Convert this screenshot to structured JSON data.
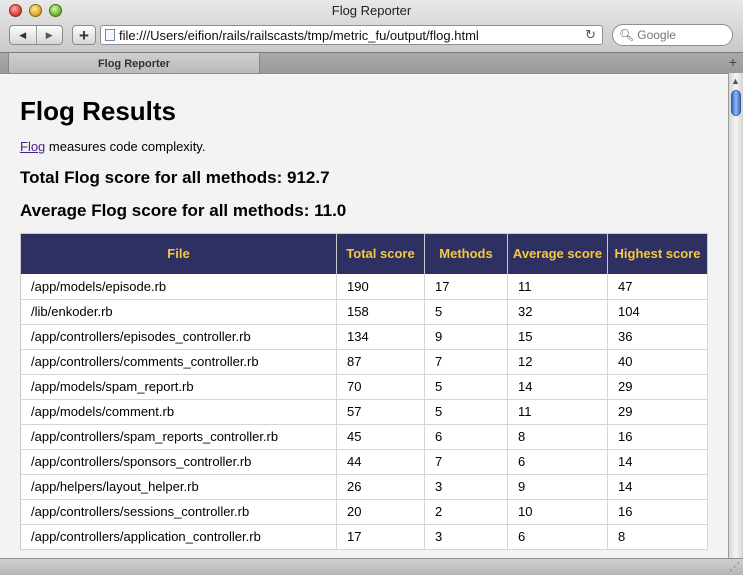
{
  "window": {
    "title": "Flog Reporter",
    "url": "file:///Users/eifion/rails/railscasts/tmp/metric_fu/output/flog.html",
    "search_placeholder": "Google",
    "tab_label": "Flog Reporter",
    "nav_back_glyph": "◀",
    "nav_forward_glyph": "▶",
    "plus_glyph": "+",
    "reload_glyph": "↻",
    "search_glyph": "🔍︎",
    "newtab_glyph": "+",
    "icons": {
      "close": "close-icon",
      "minimize": "minimize-icon",
      "zoom": "zoom-icon",
      "back": "back-arrow-icon",
      "forward": "forward-arrow-icon",
      "add_bookmark": "plus-icon",
      "page": "page-icon",
      "reload": "reload-icon",
      "search": "search-icon",
      "new_tab": "new-tab-icon"
    }
  },
  "page": {
    "heading": "Flog Results",
    "intro_link": "Flog",
    "intro_text": " measures code complexity.",
    "total_label": "Total Flog score for all methods: 912.7",
    "average_label": "Average Flog score for all methods: 11.0",
    "table": {
      "headers": [
        "File",
        "Total score",
        "Methods",
        "Average score",
        "Highest score"
      ],
      "rows": [
        [
          "/app/models/episode.rb",
          "190",
          "17",
          "11",
          "47"
        ],
        [
          "/lib/enkoder.rb",
          "158",
          "5",
          "32",
          "104"
        ],
        [
          "/app/controllers/episodes_controller.rb",
          "134",
          "9",
          "15",
          "36"
        ],
        [
          "/app/controllers/comments_controller.rb",
          "87",
          "7",
          "12",
          "40"
        ],
        [
          "/app/models/spam_report.rb",
          "70",
          "5",
          "14",
          "29"
        ],
        [
          "/app/models/comment.rb",
          "57",
          "5",
          "11",
          "29"
        ],
        [
          "/app/controllers/spam_reports_controller.rb",
          "45",
          "6",
          "8",
          "16"
        ],
        [
          "/app/controllers/sponsors_controller.rb",
          "44",
          "7",
          "6",
          "14"
        ],
        [
          "/app/helpers/layout_helper.rb",
          "26",
          "3",
          "9",
          "14"
        ],
        [
          "/app/controllers/sessions_controller.rb",
          "20",
          "2",
          "10",
          "16"
        ],
        [
          "/app/controllers/application_controller.rb",
          "17",
          "3",
          "6",
          "8"
        ]
      ]
    }
  },
  "colors": {
    "header_bg": "#2f3062",
    "header_text": "#f8c63a",
    "link": "#4a1f8c"
  }
}
